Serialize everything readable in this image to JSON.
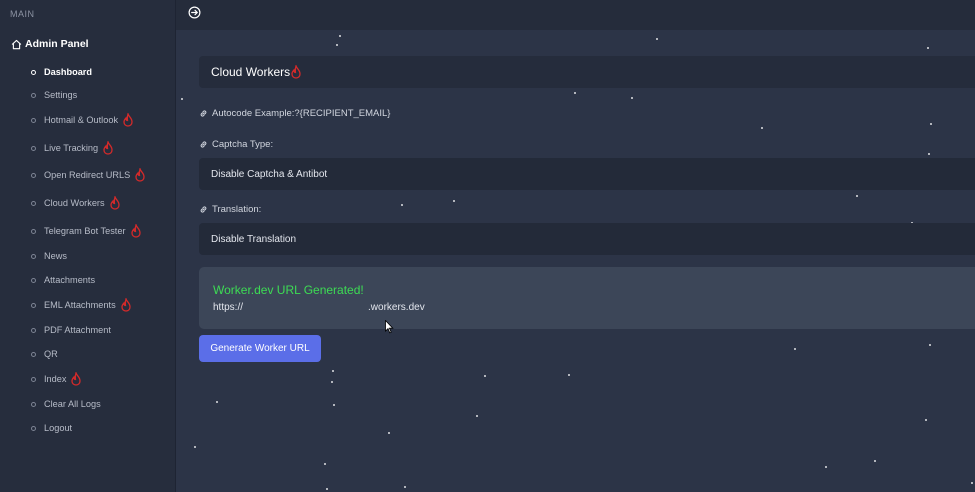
{
  "sidebar": {
    "section_label": "MAIN",
    "panel_title": "Admin Panel",
    "items": [
      {
        "label": "Dashboard",
        "active": true,
        "hot": false
      },
      {
        "label": "Settings",
        "active": false,
        "hot": false
      },
      {
        "label": "Hotmail & Outlook",
        "active": false,
        "hot": true
      },
      {
        "label": "Live Tracking",
        "active": false,
        "hot": true
      },
      {
        "label": "Open Redirect URLS",
        "active": false,
        "hot": true
      },
      {
        "label": "Cloud Workers",
        "active": false,
        "hot": true
      },
      {
        "label": "Telegram Bot Tester",
        "active": false,
        "hot": true
      },
      {
        "label": "News",
        "active": false,
        "hot": false
      },
      {
        "label": "Attachments",
        "active": false,
        "hot": false
      },
      {
        "label": "EML Attachments",
        "active": false,
        "hot": true
      },
      {
        "label": "PDF Attachment",
        "active": false,
        "hot": false
      },
      {
        "label": "QR",
        "active": false,
        "hot": false
      },
      {
        "label": "Index",
        "active": false,
        "hot": true
      },
      {
        "label": "Clear All Logs",
        "active": false,
        "hot": false
      },
      {
        "label": "Logout",
        "active": false,
        "hot": false
      }
    ]
  },
  "main": {
    "page_title": "Cloud Workers",
    "autocode_label": "Autocode Example:?{RECIPIENT_EMAIL}",
    "captcha_label": "Captcha Type:",
    "captcha_value": "Disable Captcha & Antibot",
    "translation_label": "Translation:",
    "translation_value": "Disable Translation",
    "result_title": "Worker.dev URL Generated!",
    "result_url_prefix": "https://",
    "result_url_suffix": ".workers.dev",
    "generate_button": "Generate Worker URL"
  },
  "colors": {
    "sidebar_bg": "#262d3d",
    "main_bg": "#2c3447",
    "accent_button": "#5b6ee8",
    "success_text": "#3ddc54",
    "hot_icon": "#d42a2a"
  },
  "icons": {
    "home": "home-icon",
    "toggle": "circle-arrow-right-icon",
    "link": "link-icon",
    "hot": "fire-icon"
  }
}
